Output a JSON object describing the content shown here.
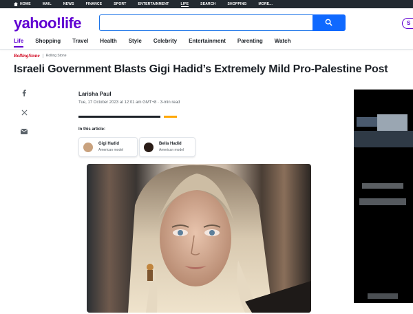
{
  "topbar": {
    "items": [
      "HOME",
      "MAIL",
      "NEWS",
      "FINANCE",
      "SPORT",
      "ENTERTAINMENT",
      "LIFE",
      "SEARCH",
      "SHOPPING",
      "MORE..."
    ],
    "active": "LIFE"
  },
  "header": {
    "logo": "yahoo!life",
    "search_placeholder": "",
    "sign_in": "S"
  },
  "subnav": {
    "items": [
      "Life",
      "Shopping",
      "Travel",
      "Health",
      "Style",
      "Celebrity",
      "Entertainment",
      "Parenting",
      "Watch"
    ],
    "active": "Life"
  },
  "source": {
    "logo": "RollingStone",
    "name": "Rolling Stone"
  },
  "article": {
    "title": "Israeli Government Blasts Gigi Hadid’s Extremely Mild Pro-Palestine Post",
    "author": "Larisha Paul",
    "date": "Tue, 17 October 2023 at 12:01 am GMT+8",
    "read_time": "3-min read",
    "in_this_article": "In this article:",
    "people": [
      {
        "name": "Gigi Hadid",
        "role": "American model",
        "avatar_color": "#c9a27e"
      },
      {
        "name": "Bella Hadid",
        "role": "American model",
        "avatar_color": "#2a1d17"
      }
    ]
  },
  "share_icons": [
    "facebook-icon",
    "x-icon",
    "mail-icon"
  ],
  "colors": {
    "brand": "#6001d2",
    "search_button": "#0f69ff",
    "topbar": "#232a31",
    "progress_accent": "#ffa700"
  }
}
